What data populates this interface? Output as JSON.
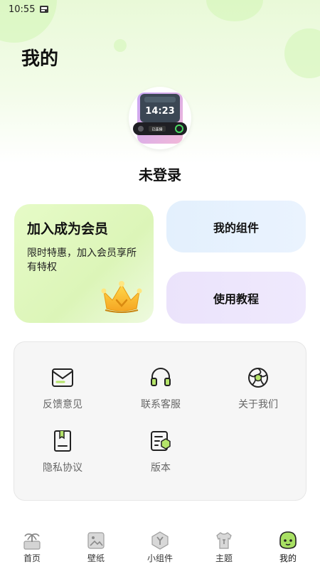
{
  "status_bar": {
    "time": "10:55"
  },
  "page": {
    "title": "我的"
  },
  "avatar": {
    "clock_time": "14:23",
    "widget_text": "已连接"
  },
  "profile": {
    "username": "未登录"
  },
  "vip": {
    "title": "加入成为会员",
    "description": "限时特惠，加入会员享所有特权"
  },
  "cards": {
    "my_widgets": "我的组件",
    "tutorial": "使用教程"
  },
  "menu": {
    "items": [
      {
        "label": "反馈意见",
        "icon": "feedback-mail-icon"
      },
      {
        "label": "联系客服",
        "icon": "headset-icon"
      },
      {
        "label": "关于我们",
        "icon": "aperture-icon"
      },
      {
        "label": "隐私协议",
        "icon": "privacy-book-icon"
      },
      {
        "label": "版本",
        "icon": "version-doc-icon"
      }
    ]
  },
  "tabs": [
    {
      "label": "首页",
      "icon": "home-palm-icon"
    },
    {
      "label": "壁纸",
      "icon": "wallpaper-icon"
    },
    {
      "label": "小组件",
      "icon": "widget-y-icon"
    },
    {
      "label": "主题",
      "icon": "theme-shirt-icon"
    },
    {
      "label": "我的",
      "icon": "profile-face-icon",
      "active": true
    }
  ],
  "colors": {
    "accent_green": "#c8f08a",
    "active_tab": "#a8e063",
    "vip_gradient": "#e6fbc7",
    "widgets_card": "#e3f0fd",
    "tutorial_card": "#ebe3fb"
  }
}
